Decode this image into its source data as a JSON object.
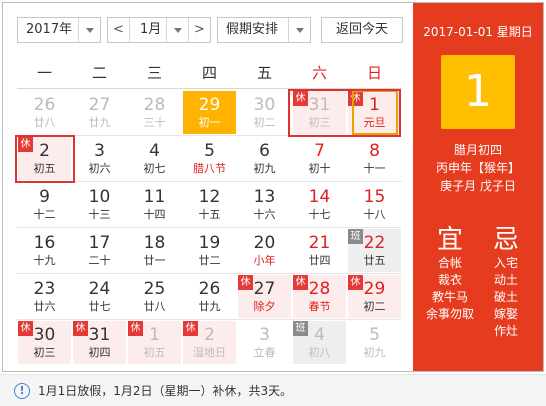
{
  "toolbar": {
    "year": "2017年",
    "prev": "<",
    "month": "1月",
    "next": ">",
    "holiday": "假期安排",
    "today": "返回今天"
  },
  "weekdays": [
    "一",
    "二",
    "三",
    "四",
    "五",
    "六",
    "日"
  ],
  "days": [
    {
      "n": "26",
      "l": "廿八",
      "dim": true
    },
    {
      "n": "27",
      "l": "廿九",
      "dim": true
    },
    {
      "n": "28",
      "l": "三十",
      "dim": true
    },
    {
      "n": "29",
      "l": "初一",
      "today": true
    },
    {
      "n": "30",
      "l": "初二",
      "dim": true
    },
    {
      "n": "31",
      "l": "初三",
      "dim": true,
      "badge": "休",
      "bg": "red"
    },
    {
      "n": "1",
      "l": "元旦",
      "badge": "休",
      "bg": "red",
      "red": true,
      "holiday": true,
      "selected": true
    },
    {
      "n": "2",
      "l": "初五",
      "badge": "休",
      "bg": "red"
    },
    {
      "n": "3",
      "l": "初六"
    },
    {
      "n": "4",
      "l": "初七"
    },
    {
      "n": "5",
      "l": "腊八节",
      "holiday": true
    },
    {
      "n": "6",
      "l": "初九"
    },
    {
      "n": "7",
      "l": "初十",
      "red": true
    },
    {
      "n": "8",
      "l": "十一",
      "red": true
    },
    {
      "n": "9",
      "l": "十二"
    },
    {
      "n": "10",
      "l": "十三"
    },
    {
      "n": "11",
      "l": "十四"
    },
    {
      "n": "12",
      "l": "十五"
    },
    {
      "n": "13",
      "l": "十六"
    },
    {
      "n": "14",
      "l": "十七",
      "red": true
    },
    {
      "n": "15",
      "l": "十八",
      "red": true
    },
    {
      "n": "16",
      "l": "十九"
    },
    {
      "n": "17",
      "l": "二十"
    },
    {
      "n": "18",
      "l": "廿一"
    },
    {
      "n": "19",
      "l": "廿二"
    },
    {
      "n": "20",
      "l": "小年",
      "holiday": true
    },
    {
      "n": "21",
      "l": "廿四",
      "red": true
    },
    {
      "n": "22",
      "l": "廿五",
      "badge": "班",
      "bg": "gray",
      "red": true
    },
    {
      "n": "23",
      "l": "廿六"
    },
    {
      "n": "24",
      "l": "廿七"
    },
    {
      "n": "25",
      "l": "廿八"
    },
    {
      "n": "26",
      "l": "廿九"
    },
    {
      "n": "27",
      "l": "除夕",
      "badge": "休",
      "bg": "red",
      "holiday": true
    },
    {
      "n": "28",
      "l": "春节",
      "badge": "休",
      "bg": "red",
      "red": true,
      "holiday": true
    },
    {
      "n": "29",
      "l": "初二",
      "badge": "休",
      "bg": "red",
      "red": true
    },
    {
      "n": "30",
      "l": "初三",
      "badge": "休",
      "bg": "red"
    },
    {
      "n": "31",
      "l": "初四",
      "badge": "休",
      "bg": "red"
    },
    {
      "n": "1",
      "l": "初五",
      "badge": "休",
      "bg": "red",
      "dim": true
    },
    {
      "n": "2",
      "l": "湿地日",
      "badge": "休",
      "bg": "red",
      "dim": true
    },
    {
      "n": "3",
      "l": "立春",
      "dim": true
    },
    {
      "n": "4",
      "l": "初八",
      "badge": "班",
      "bg": "gray",
      "dim": true
    },
    {
      "n": "5",
      "l": "初九",
      "dim": true
    }
  ],
  "panel": {
    "date": "2017-01-01 星期日",
    "day": "1",
    "lunar": "腊月初四",
    "ganzhi_year": "丙申年【猴年】",
    "ganzhi_month_day": "庚子月 戊子日",
    "yi_title": "宜",
    "ji_title": "忌",
    "yi": [
      "合帐",
      "裁衣",
      "教牛马",
      "余事勿取"
    ],
    "ji": [
      "入宅",
      "动土",
      "破土",
      "嫁娶",
      "作灶"
    ]
  },
  "notice": "1月1日放假，1月2日（星期一）补休，共3天。",
  "colors": {
    "accent_red": "#e53b1f",
    "today_yellow": "#ffb300",
    "holiday_red": "#e02020"
  }
}
